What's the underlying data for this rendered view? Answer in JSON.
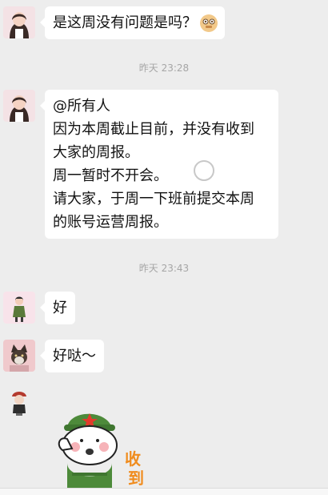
{
  "messages": [
    {
      "text": "是这周没有问题是吗？"
    },
    {
      "lines": [
        "@所有人",
        "因为本周截止目前，并没有收到",
        "大家的周报。",
        "周一暂时不开会。",
        "请大家，于周一下班前提交本周",
        "的账号运营周报。"
      ]
    },
    {
      "text": "好"
    },
    {
      "text": "好哒～"
    }
  ],
  "timestamps": [
    "昨天 23:28",
    "昨天 23:43"
  ],
  "sticker": {
    "caption_top": "收",
    "caption_bottom": "到"
  },
  "colors": {
    "background": "#ededed",
    "bubble": "#ffffff",
    "timestamp": "#a6a6a6",
    "sticker_army_green": "#4d8a3a"
  },
  "icons": [
    "avatar-girl-icon",
    "avatar-cartoon-girl-icon",
    "avatar-cat-icon",
    "avatar-soldier-icon",
    "emoji-shy-face-icon",
    "loading-spinner-icon"
  ]
}
